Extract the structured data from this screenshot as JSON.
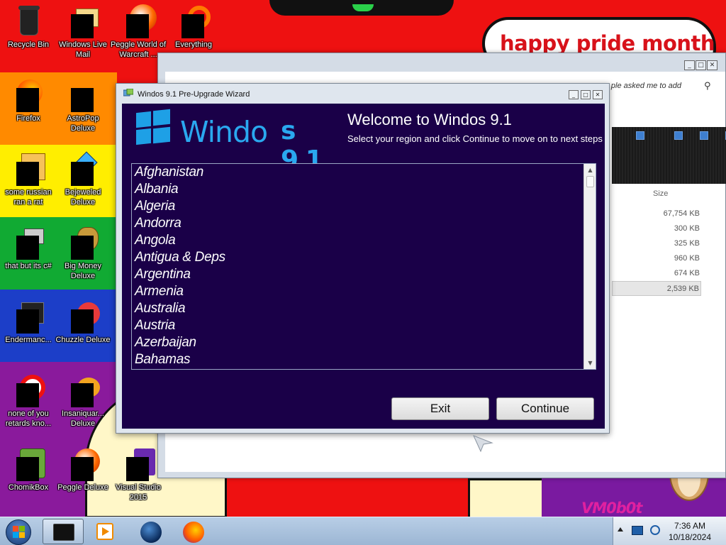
{
  "desktop": {
    "banner_text": "happy pride month",
    "graffiti_text": "VM0b0t",
    "icons": [
      {
        "id": "recycle-bin",
        "label": "Recycle Bin",
        "icon": "trash-can-icon"
      },
      {
        "id": "windows-live-mail",
        "label": "Windows Live Mail",
        "icon": "mail-icon"
      },
      {
        "id": "peggle-world-of-warcraft",
        "label": "Peggle World of Warcraft ...",
        "icon": "peggle-icon"
      },
      {
        "id": "everything",
        "label": "Everything",
        "icon": "search-magnifier-icon"
      },
      {
        "id": "firefox",
        "label": "Firefox",
        "icon": "firefox-icon"
      },
      {
        "id": "astropop-deluxe",
        "label": "AstroPop Deluxe",
        "icon": "astropop-icon"
      },
      {
        "id": "some-russian",
        "label": "some russian ran a rat",
        "icon": "document-icon"
      },
      {
        "id": "bejeweled-deluxe",
        "label": "Bejeweled Deluxe",
        "icon": "gem-icon"
      },
      {
        "id": "that-but-its-c",
        "label": "that but its c#",
        "icon": "window-stack-icon"
      },
      {
        "id": "big-money-deluxe",
        "label": "Big Money Deluxe",
        "icon": "money-bag-icon"
      },
      {
        "id": "endermanch",
        "label": "Endermanc...",
        "icon": "terminal-icon"
      },
      {
        "id": "chuzzle-deluxe",
        "label": "Chuzzle Deluxe",
        "icon": "chuzzle-icon"
      },
      {
        "id": "none-of-you",
        "label": "none of you retards kno...",
        "icon": "opera-icon"
      },
      {
        "id": "insaniquarium-deluxe",
        "label": "Insaniquar... Deluxe",
        "icon": "fish-icon"
      },
      {
        "id": "chomikbox",
        "label": "ChomikBox",
        "icon": "hamster-box-icon"
      },
      {
        "id": "peggle-deluxe",
        "label": "Peggle Deluxe",
        "icon": "peggle-icon"
      },
      {
        "id": "visual-studio-2015",
        "label": "Visual Studio 2015",
        "icon": "visual-studio-icon"
      }
    ]
  },
  "background_window": {
    "search_placeholder": "ple asked me to add",
    "size_header": "Size",
    "sizes": [
      "67,754 KB",
      "300 KB",
      "325 KB",
      "960 KB",
      "674 KB",
      "2,539 KB"
    ],
    "selected_size_index": 5
  },
  "wizard": {
    "window_title": "Windos 9.1 Pre-Upgrade Wizard",
    "logo_text": "Windo",
    "logo_version": "s 9.1",
    "heading": "Welcome to Windos 9.1",
    "subtitle": "Select your region and click Continue to move on to next steps",
    "regions": [
      "Afghanistan",
      "Albania",
      "Algeria",
      "Andorra",
      "Angola",
      "Antigua & Deps",
      "Argentina",
      "Armenia",
      "Australia",
      "Austria",
      "Azerbaijan",
      "Bahamas"
    ],
    "exit_label": "Exit",
    "continue_label": "Continue",
    "colors": {
      "client_bg": "#1a0048",
      "logo_blue": "#2aa8ef"
    }
  },
  "taskbar": {
    "pinned": [
      {
        "id": "explorer",
        "icon": "black-folder-icon",
        "active": true
      },
      {
        "id": "media-player",
        "icon": "media-player-icon",
        "active": false
      },
      {
        "id": "globe",
        "icon": "globe-icon",
        "active": false
      },
      {
        "id": "firefox",
        "icon": "firefox-icon",
        "active": false
      }
    ],
    "time": "7:36 AM",
    "date": "10/18/2024"
  }
}
